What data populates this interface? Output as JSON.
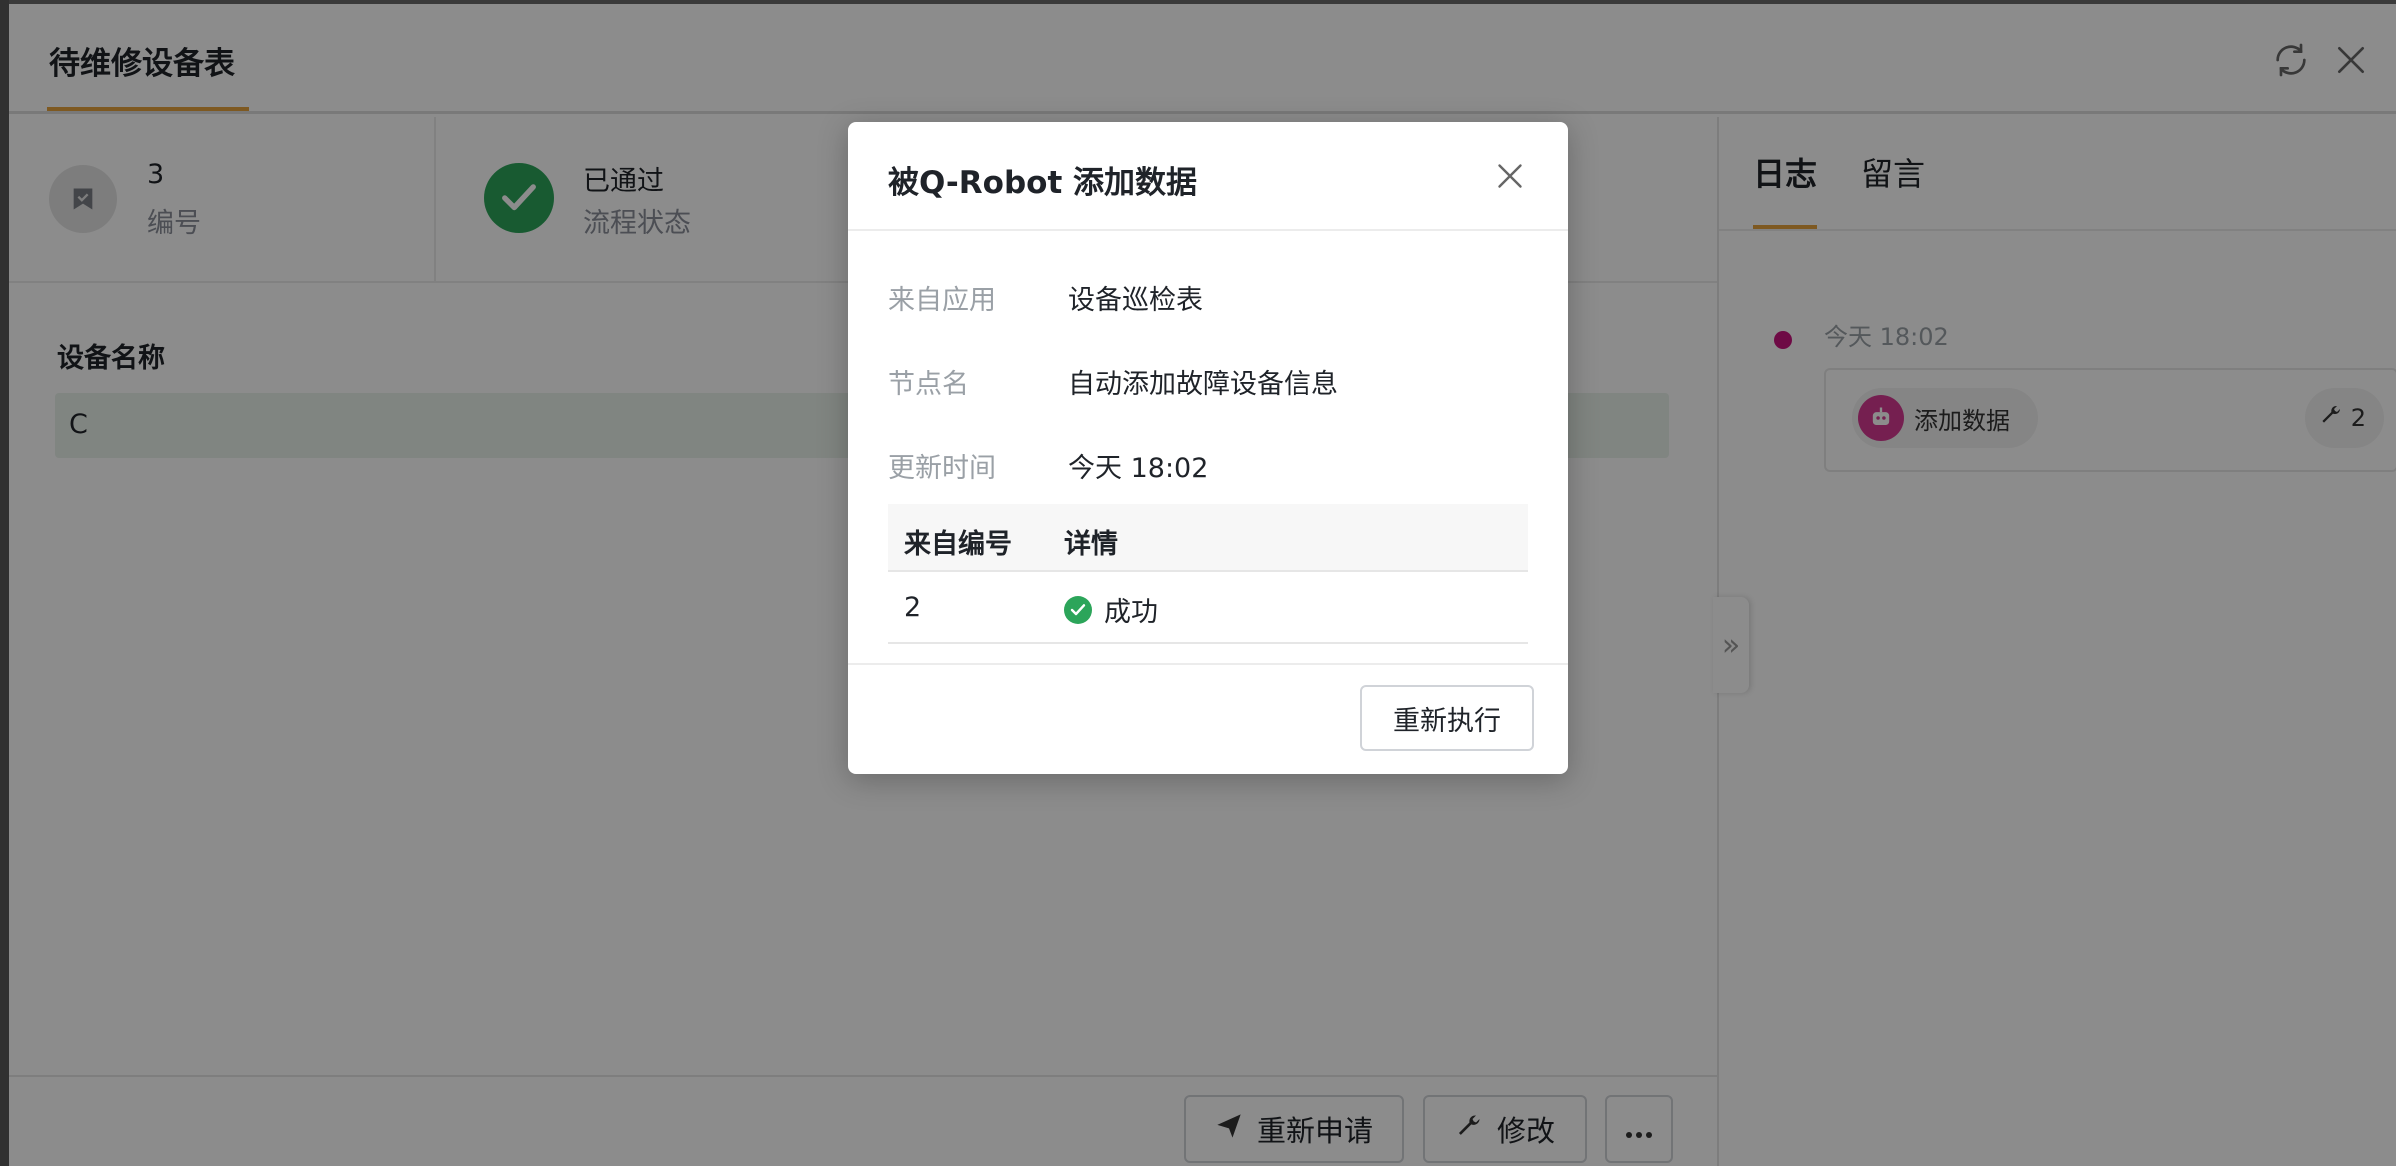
{
  "header": {
    "title": "待维修设备表",
    "refresh_icon": "refresh-icon",
    "close_icon": "close-icon"
  },
  "summary": {
    "number": {
      "value": "3",
      "label": "编号",
      "icon": "bookmark-icon"
    },
    "status": {
      "value": "已通过",
      "label": "流程状态",
      "icon": "check-icon",
      "color": "#2ca55a"
    }
  },
  "form": {
    "field_label": "设备名称",
    "field_value": "C"
  },
  "footer": {
    "reapply_label": "重新申请",
    "edit_label": "修改",
    "more_icon": "more-icon"
  },
  "right_panel": {
    "tabs": [
      {
        "label": "日志"
      },
      {
        "label": "留言"
      }
    ],
    "log": {
      "time": "今天 18:02",
      "action": "添加数据",
      "count": "2",
      "dot_color": "#c8137e"
    }
  },
  "modal": {
    "title": "被Q-Robot 添加数据",
    "rows": [
      {
        "key": "来自应用",
        "value": "设备巡检表"
      },
      {
        "key": "节点名",
        "value": "自动添加故障设备信息"
      },
      {
        "key": "更新时间",
        "value": "今天 18:02"
      }
    ],
    "table": {
      "headers": [
        "来自编号",
        "详情"
      ],
      "rows": [
        {
          "id": "2",
          "detail": "成功"
        }
      ]
    },
    "rerun_label": "重新执行"
  },
  "colors": {
    "accent": "#e6a23c",
    "success": "#2ca55a",
    "robot": "#d63a93"
  }
}
